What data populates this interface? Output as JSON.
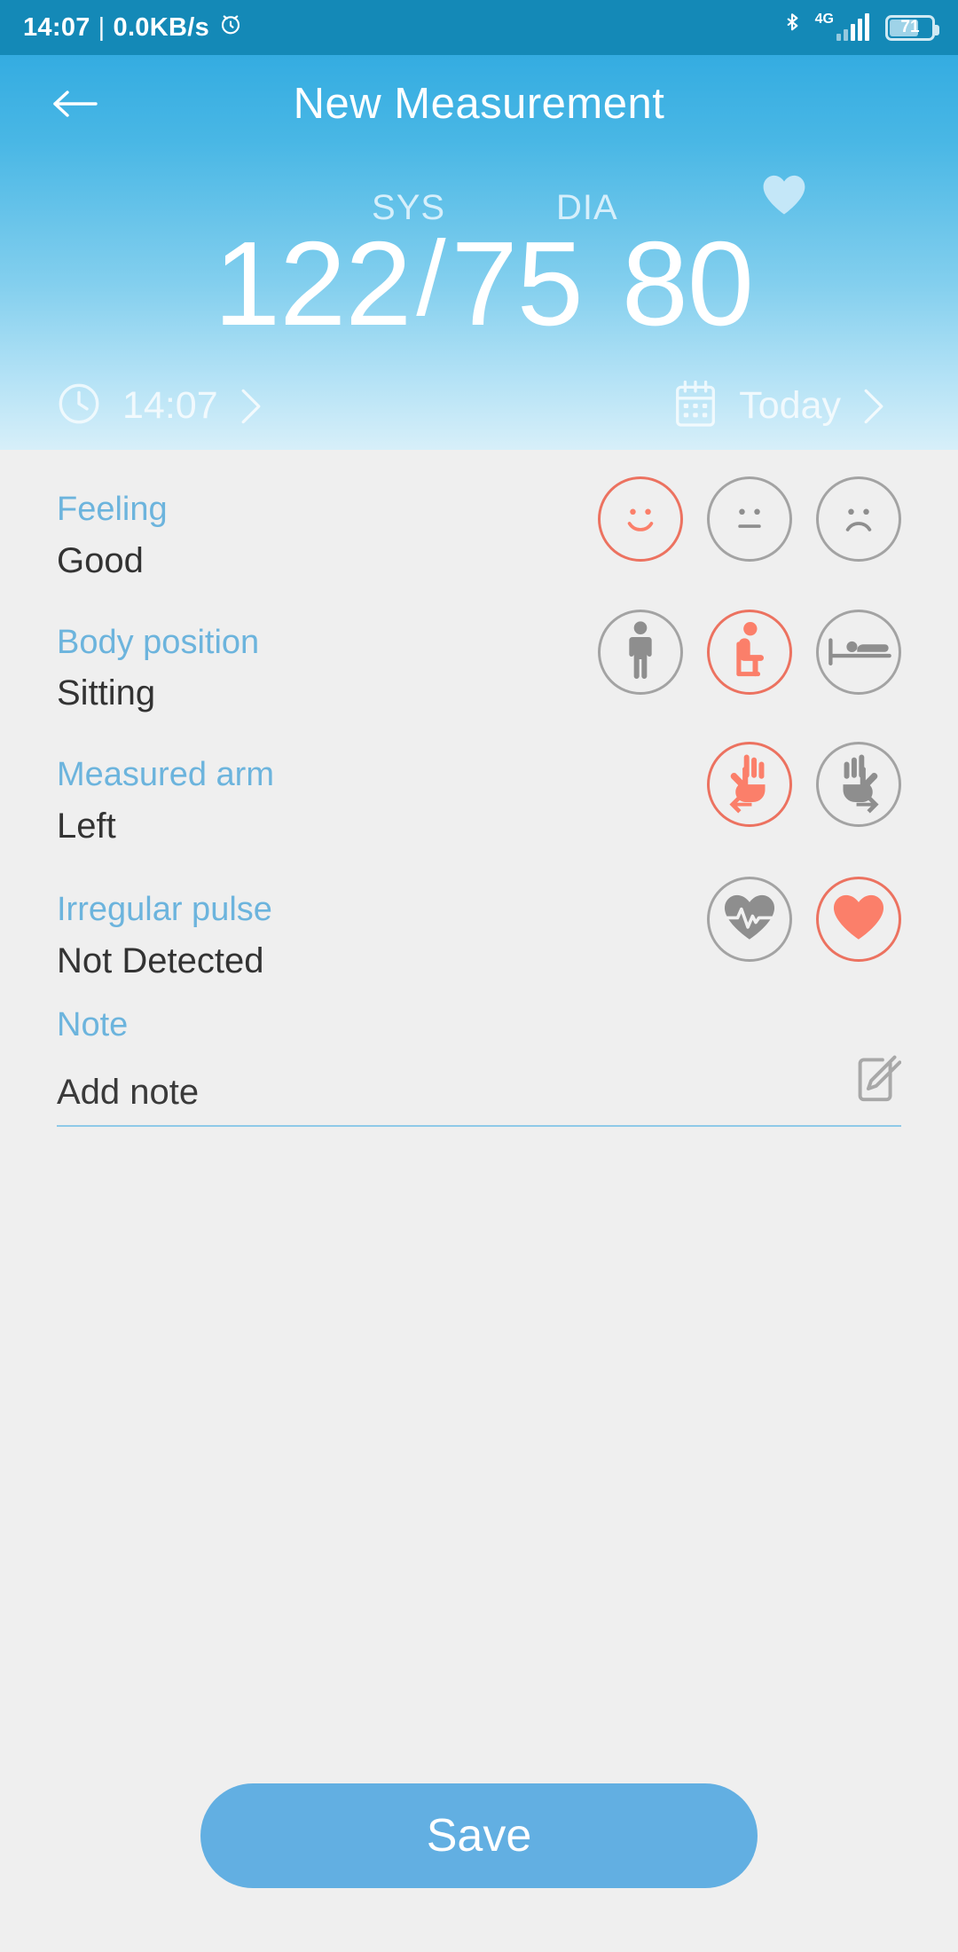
{
  "status_bar": {
    "time": "14:07",
    "separator": "|",
    "network_speed": "0.0KB/s",
    "alarm_icon": "alarm-clock-icon",
    "bluetooth_icon": "bluetooth-icon",
    "network_type": "4G",
    "battery_percent": "71"
  },
  "header": {
    "back_icon": "back-arrow-icon",
    "title": "New Measurement"
  },
  "reading": {
    "systolic": "122",
    "slash": "/",
    "diastolic": "75",
    "pulse": "80",
    "sys_label": "SYS",
    "dia_label": "DIA",
    "heart_icon": "heart-icon",
    "time": {
      "icon": "clock-icon",
      "value": "14:07",
      "chevron": "chevron-right-icon"
    },
    "date": {
      "icon": "calendar-icon",
      "value": "Today",
      "chevron": "chevron-right-icon"
    }
  },
  "fields": {
    "feeling": {
      "label": "Feeling",
      "value": "Good",
      "options": [
        {
          "name": "face-happy-icon",
          "selected": true
        },
        {
          "name": "face-neutral-icon",
          "selected": false
        },
        {
          "name": "face-sad-icon",
          "selected": false
        }
      ]
    },
    "body_position": {
      "label": "Body position",
      "value": "Sitting",
      "options": [
        {
          "name": "person-standing-icon",
          "selected": false
        },
        {
          "name": "person-sitting-icon",
          "selected": true
        },
        {
          "name": "person-lying-icon",
          "selected": false
        }
      ]
    },
    "measured_arm": {
      "label": "Measured arm",
      "value": "Left",
      "options": [
        {
          "name": "hand-left-icon",
          "selected": true
        },
        {
          "name": "hand-right-icon",
          "selected": false
        }
      ]
    },
    "irregular_pulse": {
      "label": "Irregular pulse",
      "value": "Not Detected",
      "options": [
        {
          "name": "heart-pulse-icon",
          "selected": false
        },
        {
          "name": "heart-solid-icon",
          "selected": true
        }
      ]
    },
    "note": {
      "label": "Note",
      "placeholder": "Add note",
      "value": "",
      "edit_icon": "edit-note-icon"
    }
  },
  "actions": {
    "save_label": "Save"
  },
  "colors": {
    "accent_blue": "#6cb4dd",
    "hero_blue": "#34ace1",
    "status_blue": "#1489b7",
    "selected_coral": "#ec7260",
    "unselected_gray": "#a3a3a3",
    "save_button": "#62afe2",
    "page_background": "#efefef"
  }
}
